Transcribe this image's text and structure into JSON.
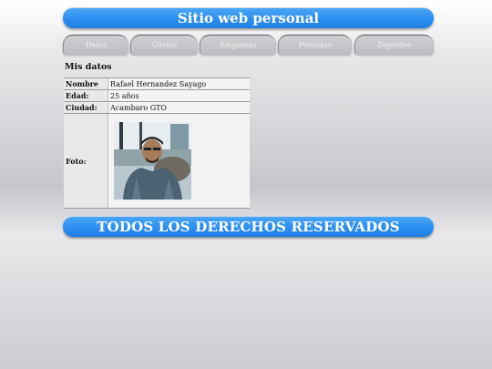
{
  "header": {
    "title": "Sitio web personal"
  },
  "nav": {
    "tabs": [
      {
        "label": "Datos"
      },
      {
        "label": "Gustos"
      },
      {
        "label": "Empresas"
      },
      {
        "label": "Películas"
      },
      {
        "label": "Deportes"
      }
    ]
  },
  "section": {
    "title": "Mis datos"
  },
  "profile": {
    "rows": [
      {
        "label": "Nombre",
        "value": "Rafael Hernandez Sayago"
      },
      {
        "label": "Edad:",
        "value": "25 años"
      },
      {
        "label": "Ciudad:",
        "value": "Acambaro GTO"
      },
      {
        "label": "Foto:",
        "value": ""
      }
    ]
  },
  "footer": {
    "text": "TODOS LOS DERECHOS RESERVADOS"
  },
  "colors": {
    "banner": "#2c8ef0",
    "tab": "#c6c6cb",
    "background": "#d3d4d7"
  }
}
